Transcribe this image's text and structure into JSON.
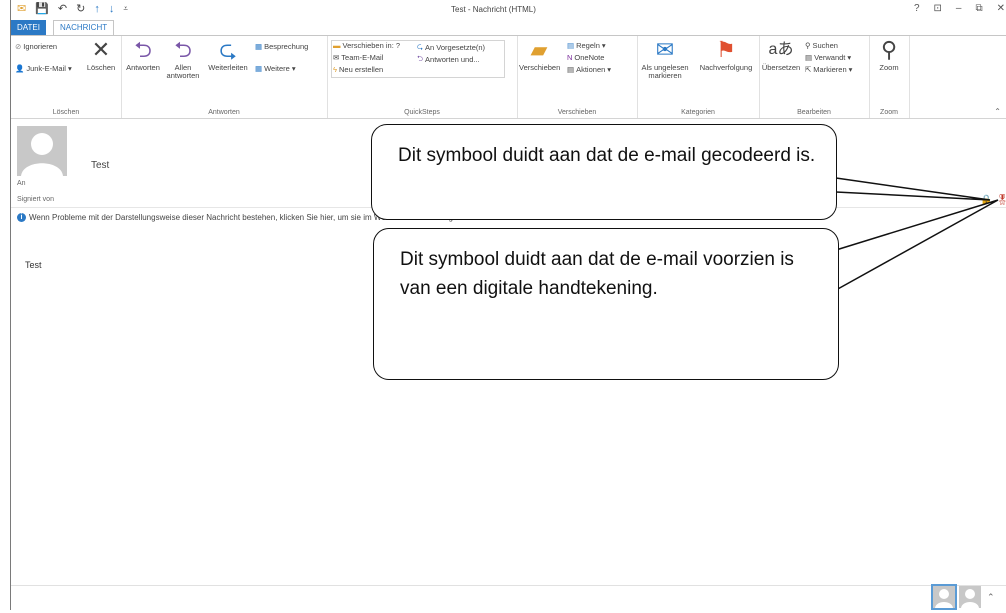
{
  "titlebar": {
    "title": "Test    - Nachricht (HTML)",
    "help": "?",
    "ribbon_display": "⊡",
    "minimize": "–",
    "restore": "⧉",
    "close": "✕"
  },
  "tabs": {
    "datei": "DATEI",
    "nachricht": "NACHRICHT"
  },
  "ribbon": {
    "loeschen": {
      "ignorieren": "Ignorieren",
      "junk": "Junk-E-Mail",
      "loeschen": "Löschen",
      "label": "Löschen"
    },
    "antworten": {
      "antworten": "Antworten",
      "allen": "Allen antworten",
      "weiterleiten": "Weiterleiten",
      "besprechung": "Besprechung",
      "weitere": "Weitere",
      "label": "Antworten"
    },
    "quicksteps": {
      "verschieben_in": "Verschieben in: ?",
      "team": "Team-E-Mail",
      "neu": "Neu erstellen",
      "vorgesetzte": "An Vorgesetzte(n)",
      "antworten_und": "Antworten und...",
      "label": "QuickSteps"
    },
    "verschieben": {
      "verschieben": "Verschieben",
      "regeln": "Regeln",
      "onenote": "OneNote",
      "aktionen": "Aktionen",
      "label": "Verschieben"
    },
    "kategorien": {
      "ungelesen": "Als ungelesen markieren",
      "nachverfolgung": "Nachverfolgung",
      "label": "Kategorien"
    },
    "bearbeiten": {
      "uebersetzen": "Übersetzen",
      "suchen": "Suchen",
      "verwandt": "Verwandt",
      "markieren": "Markieren",
      "label": "Bearbeiten"
    },
    "zoom": {
      "zoom": "Zoom",
      "label": "Zoom"
    }
  },
  "message": {
    "sender": "Test",
    "an": "An",
    "signiert": "Signiert von",
    "info": "Wenn Probleme mit der Darstellungsweise dieser Nachricht bestehen, klicken Sie hier, um sie im Webbrowser anzuzeigen.",
    "body": "Test"
  },
  "callouts": {
    "encrypted": "Dit symbool duidt aan dat de e-mail gecodeerd is.",
    "signed": "Dit symbool duidt aan dat de e-mail voorzien is van een digitale handtekening."
  },
  "colors": {
    "accent": "#2b79c5",
    "lock": "#e8a23a",
    "seal": "#c0392b"
  }
}
